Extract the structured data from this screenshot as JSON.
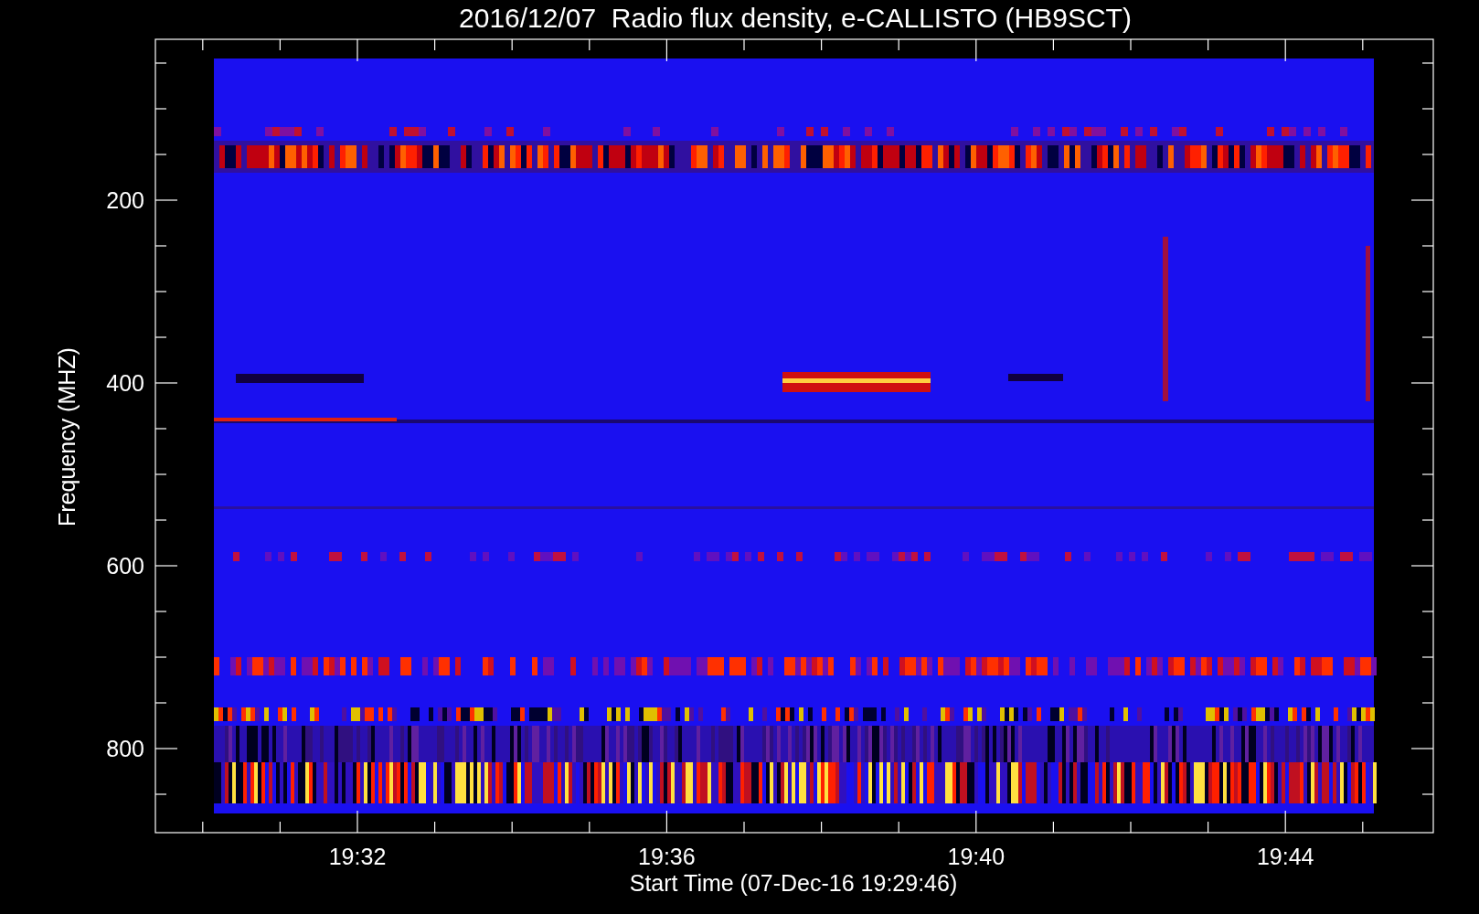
{
  "title": "2016/12/07  Radio flux density, e-CALLISTO (HB9SCT)",
  "y_axis": {
    "label": "Frequency (MHZ)",
    "ticks": [
      "200",
      "400",
      "600",
      "800"
    ]
  },
  "x_axis": {
    "label": "Start Time (07-Dec-16 19:29:46)",
    "ticks": [
      "19:32",
      "19:36",
      "19:40",
      "19:44"
    ]
  }
}
